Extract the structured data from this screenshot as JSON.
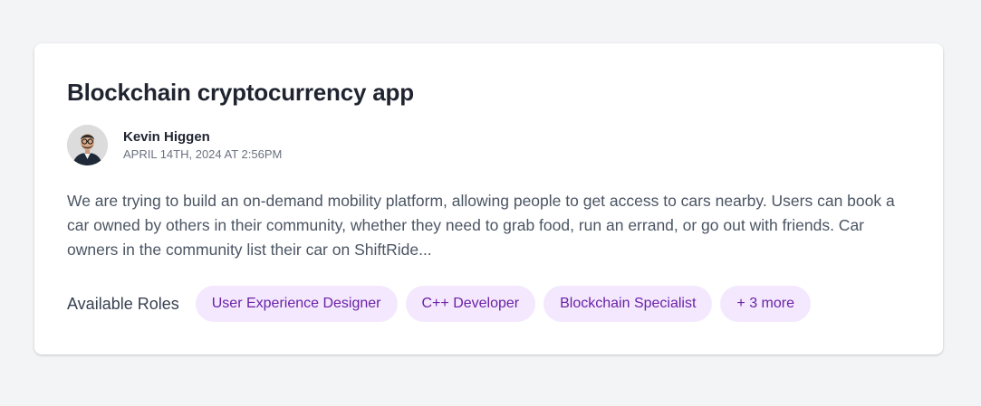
{
  "project": {
    "title": "Blockchain cryptocurrency app",
    "author": {
      "name": "Kevin Higgen",
      "date": "APRIL 14TH, 2024 AT 2:56PM",
      "avatar_icon": "person-avatar"
    },
    "description": "We are trying to build an on-demand mobility platform, allowing people to get access to cars nearby. Users can book a car owned by others in their community, whether they need to grab food, run an errand, or go out with friends. Car owners in the community list their car on ShiftRide...",
    "roles_label": "Available Roles",
    "roles": [
      "User Experience Designer",
      "C++ Developer",
      "Blockchain Specialist"
    ],
    "more_roles": "+ 3 more"
  },
  "colors": {
    "page_background": "#f3f4f6",
    "card_background": "#ffffff",
    "chip_background": "#f3e8fd",
    "chip_text": "#6b21a8",
    "title_text": "#1f2430",
    "body_text": "#4b5563"
  }
}
